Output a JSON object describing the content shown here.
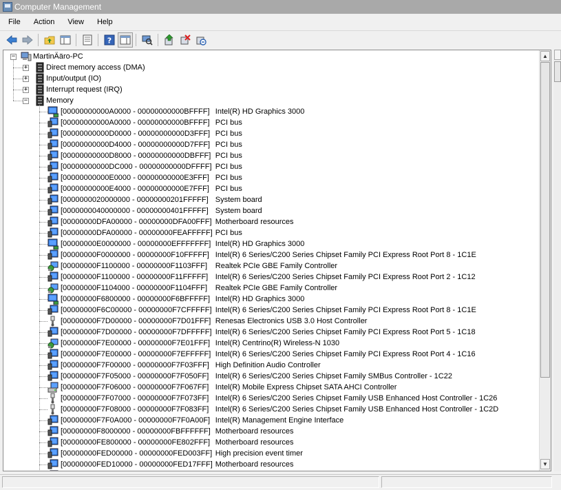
{
  "window": {
    "title": "Computer Management"
  },
  "menu": [
    "File",
    "Action",
    "View",
    "Help"
  ],
  "toolbar": [
    {
      "name": "back-arrow-icon",
      "sep_after": false
    },
    {
      "name": "forward-arrow-icon",
      "sep_after": true
    },
    {
      "name": "up-folder-icon",
      "sep_after": false
    },
    {
      "name": "show-hide-tree-icon",
      "sep_after": true
    },
    {
      "name": "properties-icon",
      "sep_after": true
    },
    {
      "name": "help-icon",
      "sep_after": false
    },
    {
      "name": "action-pane-icon",
      "sep_after": true
    },
    {
      "name": "scan-hardware-icon",
      "sep_after": true
    },
    {
      "name": "update-driver-icon",
      "sep_after": false
    },
    {
      "name": "disable-device-icon",
      "sep_after": false
    },
    {
      "name": "uninstall-device-icon",
      "sep_after": false
    }
  ],
  "tree": {
    "computer": "MartinÄäro-PC",
    "categories": [
      {
        "label": "Direct memory access (DMA)",
        "expander": "+"
      },
      {
        "label": "Input/output (IO)",
        "expander": "+"
      },
      {
        "label": "Interrupt request (IRQ)",
        "expander": "+"
      },
      {
        "label": "Memory",
        "expander": "−"
      }
    ],
    "memory_items": [
      {
        "range": "[00000000000A0000 - 00000000000BFFFF]",
        "desc": "Intel(R) HD Graphics 3000",
        "icon": "display-icon"
      },
      {
        "range": "[00000000000A0000 - 00000000000BFFFF]",
        "desc": "PCI bus",
        "icon": "system-device-icon"
      },
      {
        "range": "[00000000000D0000 - 00000000000D3FFF]",
        "desc": "PCI bus",
        "icon": "system-device-icon"
      },
      {
        "range": "[00000000000D4000 - 00000000000D7FFF]",
        "desc": "PCI bus",
        "icon": "system-device-icon"
      },
      {
        "range": "[00000000000D8000 - 00000000000DBFFF]",
        "desc": "PCI bus",
        "icon": "system-device-icon"
      },
      {
        "range": "[00000000000DC000 - 00000000000DFFFF]",
        "desc": "PCI bus",
        "icon": "system-device-icon"
      },
      {
        "range": "[00000000000E0000 - 00000000000E3FFF]",
        "desc": "PCI bus",
        "icon": "system-device-icon"
      },
      {
        "range": "[00000000000E4000 - 00000000000E7FFF]",
        "desc": "PCI bus",
        "icon": "system-device-icon"
      },
      {
        "range": "[0000000020000000 - 00000000201FFFFF]",
        "desc": "System board",
        "icon": "system-device-icon"
      },
      {
        "range": "[0000000040000000 - 00000000401FFFFF]",
        "desc": "System board",
        "icon": "system-device-icon"
      },
      {
        "range": "[00000000DFA00000 - 00000000DFA00FFF]",
        "desc": "Motherboard resources",
        "icon": "system-device-icon"
      },
      {
        "range": "[00000000DFA00000 - 00000000FEAFFFFF]",
        "desc": "PCI bus",
        "icon": "system-device-icon"
      },
      {
        "range": "[00000000E0000000 - 00000000EFFFFFFF]",
        "desc": "Intel(R) HD Graphics 3000",
        "icon": "display-icon"
      },
      {
        "range": "[00000000F0000000 - 00000000F10FFFFF]",
        "desc": "Intel(R) 6 Series/C200 Series Chipset Family PCI Express Root Port 8 - 1C1E",
        "icon": "system-device-icon"
      },
      {
        "range": "[00000000F1100000 - 00000000F1103FFF]",
        "desc": "Realtek PCIe GBE Family Controller",
        "icon": "network-icon"
      },
      {
        "range": "[00000000F1100000 - 00000000F11FFFFF]",
        "desc": "Intel(R) 6 Series/C200 Series Chipset Family PCI Express Root Port 2 - 1C12",
        "icon": "system-device-icon"
      },
      {
        "range": "[00000000F1104000 - 00000000F1104FFF]",
        "desc": "Realtek PCIe GBE Family Controller",
        "icon": "network-icon"
      },
      {
        "range": "[00000000F6800000 - 00000000F6BFFFFF]",
        "desc": "Intel(R) HD Graphics 3000",
        "icon": "display-icon"
      },
      {
        "range": "[00000000F6C00000 - 00000000F7CFFFFF]",
        "desc": "Intel(R) 6 Series/C200 Series Chipset Family PCI Express Root Port 8 - 1C1E",
        "icon": "system-device-icon"
      },
      {
        "range": "[00000000F7D00000 - 00000000F7D01FFF]",
        "desc": "Renesas Electronics USB 3.0 Host Controller",
        "icon": "usb-icon"
      },
      {
        "range": "[00000000F7D00000 - 00000000F7DFFFFF]",
        "desc": "Intel(R) 6 Series/C200 Series Chipset Family PCI Express Root Port 5 - 1C18",
        "icon": "system-device-icon"
      },
      {
        "range": "[00000000F7E00000 - 00000000F7E01FFF]",
        "desc": "Intel(R) Centrino(R) Wireless-N 1030",
        "icon": "network-icon"
      },
      {
        "range": "[00000000F7E00000 - 00000000F7EFFFFF]",
        "desc": "Intel(R) 6 Series/C200 Series Chipset Family PCI Express Root Port 4 - 1C16",
        "icon": "system-device-icon"
      },
      {
        "range": "[00000000F7F00000 - 00000000F7F03FFF]",
        "desc": "High Definition Audio Controller",
        "icon": "system-device-icon"
      },
      {
        "range": "[00000000F7F05000 - 00000000F7F050FF]",
        "desc": "Intel(R) 6 Series/C200 Series Chipset Family SMBus Controller - 1C22",
        "icon": "system-device-icon"
      },
      {
        "range": "[00000000F7F06000 - 00000000F7F067FF]",
        "desc": "Intel(R) Mobile Express Chipset SATA AHCI Controller",
        "icon": "storage-icon"
      },
      {
        "range": "[00000000F7F07000 - 00000000F7F073FF]",
        "desc": "Intel(R) 6 Series/C200 Series Chipset Family USB Enhanced Host Controller - 1C26",
        "icon": "usb-icon"
      },
      {
        "range": "[00000000F7F08000 - 00000000F7F083FF]",
        "desc": "Intel(R) 6 Series/C200 Series Chipset Family USB Enhanced Host Controller - 1C2D",
        "icon": "usb-icon"
      },
      {
        "range": "[00000000F7F0A000 - 00000000F7F0A00F]",
        "desc": "Intel(R) Management Engine Interface",
        "icon": "system-device-icon"
      },
      {
        "range": "[00000000F8000000 - 00000000FBFFFFFF]",
        "desc": "Motherboard resources",
        "icon": "system-device-icon"
      },
      {
        "range": "[00000000FE800000 - 00000000FE802FFF]",
        "desc": "Motherboard resources",
        "icon": "system-device-icon"
      },
      {
        "range": "[00000000FED00000 - 00000000FED003FF]",
        "desc": "High precision event timer",
        "icon": "system-device-icon"
      },
      {
        "range": "[00000000FED10000 - 00000000FED17FFF]",
        "desc": "Motherboard resources",
        "icon": "system-device-icon"
      }
    ]
  },
  "colors": {
    "titlebar": "#a9a9a9",
    "selection": "#3399ff"
  }
}
